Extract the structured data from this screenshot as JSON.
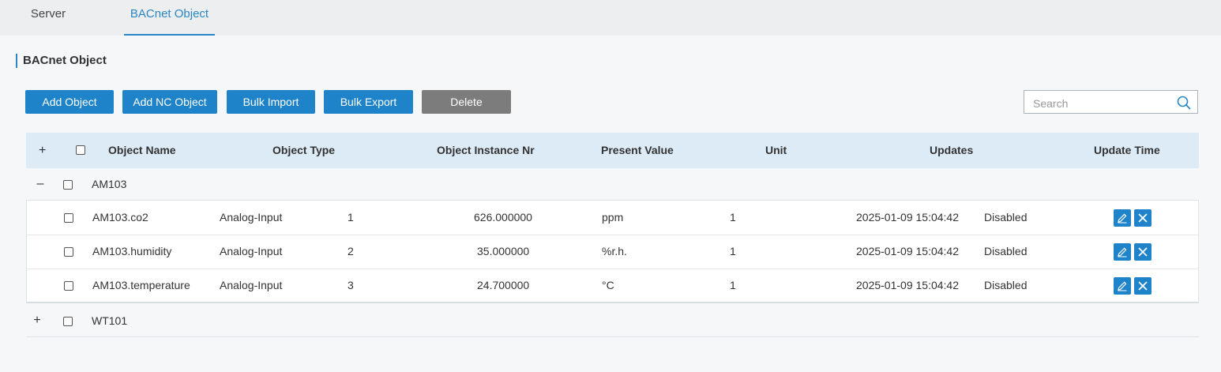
{
  "tabs": [
    {
      "label": "Server"
    },
    {
      "label": "BACnet Object",
      "active": true
    }
  ],
  "section_title": "BACnet Object",
  "toolbar": {
    "add_object": "Add Object",
    "add_nc_object": "Add NC Object",
    "bulk_import": "Bulk Import",
    "bulk_export": "Bulk Export",
    "delete": "Delete"
  },
  "search": {
    "placeholder": "Search",
    "value": ""
  },
  "table": {
    "headers": {
      "expand": "+",
      "object_name": "Object Name",
      "object_type": "Object Type",
      "object_instance": "Object Instance Nr",
      "present_value": "Present Value",
      "unit": "Unit",
      "updates": "Updates",
      "update_time": "Update Time"
    },
    "groups": [
      {
        "name": "AM103",
        "toggle": "–",
        "expanded": true,
        "rows": [
          {
            "name": "AM103.co2",
            "type": "Analog-Input",
            "instance": "1",
            "present_value": "626.000000",
            "unit": "ppm",
            "updates": "1",
            "update_time": "2025-01-09 15:04:42",
            "status": "Disabled"
          },
          {
            "name": "AM103.humidity",
            "type": "Analog-Input",
            "instance": "2",
            "present_value": "35.000000",
            "unit": "%r.h.",
            "updates": "1",
            "update_time": "2025-01-09 15:04:42",
            "status": "Disabled"
          },
          {
            "name": "AM103.temperature",
            "type": "Analog-Input",
            "instance": "3",
            "present_value": "24.700000",
            "unit": "°C",
            "updates": "1",
            "update_time": "2025-01-09 15:04:42",
            "status": "Disabled"
          }
        ]
      },
      {
        "name": "WT101",
        "toggle": "+",
        "expanded": false,
        "rows": []
      }
    ]
  },
  "colors": {
    "accent": "#1e83c8",
    "delete_button": "#7c7c7c",
    "header_bg": "#dcebf6"
  },
  "icons": {
    "search": "search-icon",
    "edit": "pencil-icon",
    "remove": "close-icon"
  }
}
